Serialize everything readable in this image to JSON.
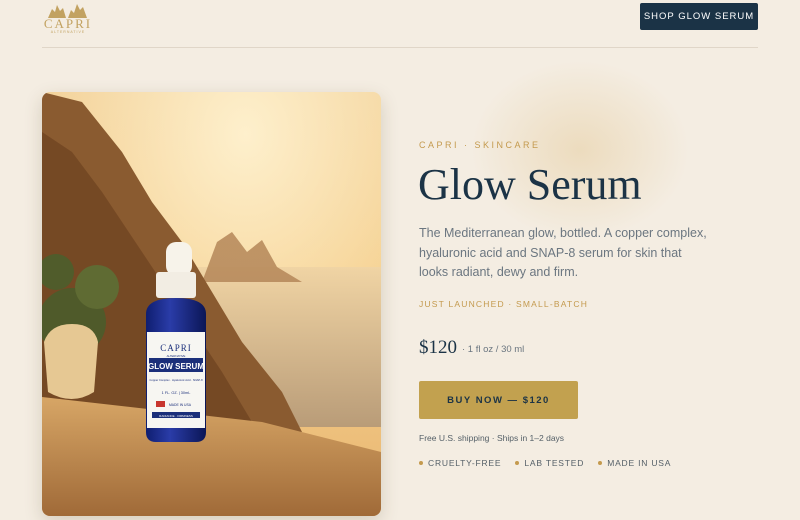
{
  "brand": {
    "logo_text": "CAPRI",
    "logo_subtext": "ALTERNATIVE"
  },
  "header": {
    "cta_label": "SHOP GLOW SERUM"
  },
  "product": {
    "eyebrow": "CAPRI · SKINCARE",
    "title": "Glow Serum",
    "description": "The Mediterranean glow, bottled. A copper complex, hyaluronic acid and SNAP-8 serum for skin that looks radiant, dewy and firm.",
    "tag": "JUST LAUNCHED · SMALL-BATCH",
    "price": "$120",
    "size": "· 1 fl oz / 30 ml",
    "buy_label": "BUY NOW — $120",
    "shipping": "Free U.S. shipping · Ships in 1–2 days",
    "features": [
      "CRUELTY-FREE",
      "LAB TESTED",
      "MADE IN USA"
    ]
  },
  "bottle_label": {
    "brand": "CAPRI",
    "brand_sub": "ALTERNATIVE",
    "name": "GLOW SERUM",
    "ingredients": "Copper Complex · Hyaluronic Acid · SNAP-8",
    "volume": "1 FL. OZ. | 30mL",
    "origin": "MADE IN USA",
    "footer": "RADIANCE · FIRMNESS"
  },
  "colors": {
    "background": "#f4ede2",
    "navy": "#1b3346",
    "gold": "#c2a14f",
    "accent_text": "#c49a4e"
  },
  "icons": [
    "logo-rocks-icon",
    "bullet-dot-icon",
    "us-flag-icon"
  ]
}
